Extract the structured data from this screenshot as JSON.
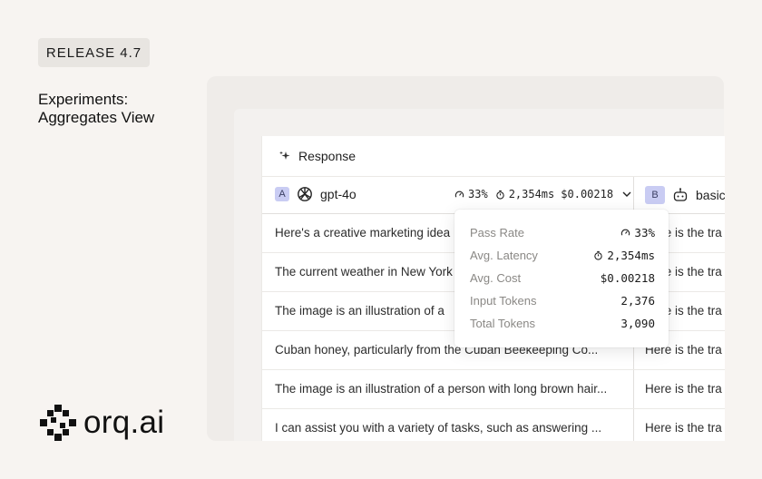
{
  "badge": "RELEASE 4.7",
  "headline": {
    "line1": "Experiments:",
    "line2": "Aggregates View"
  },
  "brand": {
    "name": "orq.ai"
  },
  "panel": {
    "section_label": "Response",
    "model_a": {
      "badge": "A",
      "name": "gpt-4o",
      "pass_rate": "33%",
      "latency": "2,354ms",
      "cost": "$0.00218"
    },
    "model_b": {
      "badge": "B",
      "name": "basic"
    },
    "rows": [
      {
        "a": "Here's a creative marketing idea",
        "b": "Here is the tra"
      },
      {
        "a": "The current weather in New York",
        "b": "Here is the tra"
      },
      {
        "a": "The image is an illustration of a",
        "b": "Here is the tra"
      },
      {
        "a": "Cuban honey, particularly from the Cuban Beekeeping Co...",
        "b": "Here is the tra"
      },
      {
        "a": "The image is an illustration of a person with long brown hair...",
        "b": "Here is the tra"
      },
      {
        "a": "I can assist you with a variety of tasks, such as answering ...",
        "b": "Here is the tra"
      }
    ]
  },
  "tooltip": {
    "pass_rate_label": "Pass Rate",
    "pass_rate_value": "33%",
    "latency_label": "Avg. Latency",
    "latency_value": "2,354ms",
    "cost_label": "Avg. Cost",
    "cost_value": "$0.00218",
    "input_label": "Input Tokens",
    "input_value": "2,376",
    "total_label": "Total Tokens",
    "total_value": "3,090"
  },
  "icons": [
    "sparkle-icon",
    "openai-logo-icon",
    "gauge-icon",
    "stopwatch-icon",
    "chevron-down-icon",
    "robot-icon",
    "orq-logo-icon"
  ]
}
